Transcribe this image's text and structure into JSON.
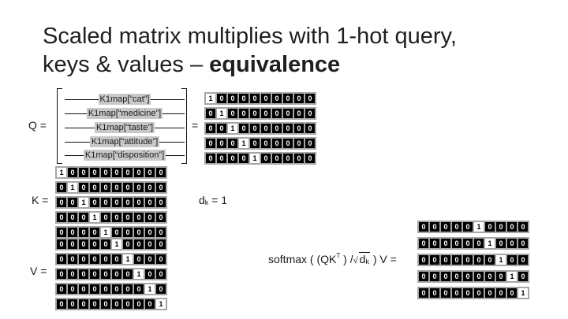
{
  "title": {
    "line1": "Scaled matrix multiplies with 1-hot query,",
    "line2_prefix": "keys & values – ",
    "line2_bold": "equivalence"
  },
  "labels": {
    "q": "Q =",
    "eq": "=",
    "k": "K =",
    "v": "V =",
    "dk_d": "d",
    "dk_sub": "k",
    "dk_rest": " = 1",
    "softmax_pre": "softmax ( (QK",
    "softmax_sup": "T",
    "softmax_mid": " ) /",
    "sqrt_d": "d",
    "sqrt_sub": "k",
    "softmax_post": " ) V ="
  },
  "q_rows": [
    "K1map[“cat”]",
    "K1map[“medicine”]",
    "K1map[“taste”]",
    "K1map[“attitude”]",
    "K1map[“disposition”]"
  ],
  "matrices": {
    "q_result": [
      [
        1,
        0,
        0,
        0,
        0,
        0,
        0,
        0,
        0,
        0
      ],
      [
        0,
        1,
        0,
        0,
        0,
        0,
        0,
        0,
        0,
        0
      ],
      [
        0,
        0,
        1,
        0,
        0,
        0,
        0,
        0,
        0,
        0
      ],
      [
        0,
        0,
        0,
        1,
        0,
        0,
        0,
        0,
        0,
        0
      ],
      [
        0,
        0,
        0,
        0,
        1,
        0,
        0,
        0,
        0,
        0
      ]
    ],
    "k": [
      [
        1,
        0,
        0,
        0,
        0,
        0,
        0,
        0,
        0,
        0
      ],
      [
        0,
        1,
        0,
        0,
        0,
        0,
        0,
        0,
        0,
        0
      ],
      [
        0,
        0,
        1,
        0,
        0,
        0,
        0,
        0,
        0,
        0
      ],
      [
        0,
        0,
        0,
        1,
        0,
        0,
        0,
        0,
        0,
        0
      ],
      [
        0,
        0,
        0,
        0,
        1,
        0,
        0,
        0,
        0,
        0
      ]
    ],
    "v": [
      [
        0,
        0,
        0,
        0,
        0,
        1,
        0,
        0,
        0,
        0
      ],
      [
        0,
        0,
        0,
        0,
        0,
        0,
        1,
        0,
        0,
        0
      ],
      [
        0,
        0,
        0,
        0,
        0,
        0,
        0,
        1,
        0,
        0
      ],
      [
        0,
        0,
        0,
        0,
        0,
        0,
        0,
        0,
        1,
        0
      ],
      [
        0,
        0,
        0,
        0,
        0,
        0,
        0,
        0,
        0,
        1
      ]
    ],
    "result": [
      [
        0,
        0,
        0,
        0,
        0,
        1,
        0,
        0,
        0,
        0
      ],
      [
        0,
        0,
        0,
        0,
        0,
        0,
        1,
        0,
        0,
        0
      ],
      [
        0,
        0,
        0,
        0,
        0,
        0,
        0,
        1,
        0,
        0
      ],
      [
        0,
        0,
        0,
        0,
        0,
        0,
        0,
        0,
        1,
        0
      ],
      [
        0,
        0,
        0,
        0,
        0,
        0,
        0,
        0,
        0,
        1
      ]
    ]
  }
}
